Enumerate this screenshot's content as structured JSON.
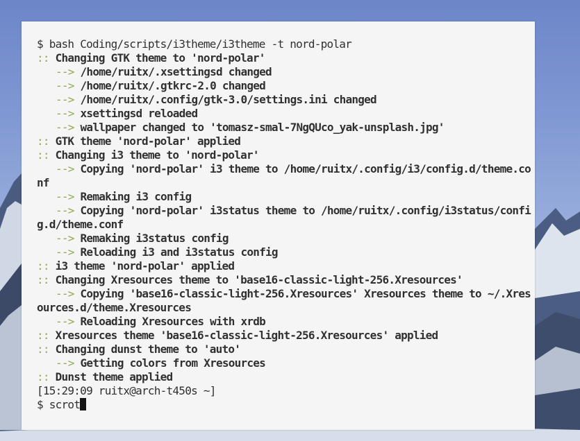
{
  "wallpaper": {
    "name": "tomasz-smal-7NgQUco_yak-unsplash.jpg"
  },
  "colors": {
    "terminal_bg": "#f5f5f5",
    "text": "#303030",
    "accent_green": "#90a959",
    "cursor": "#151515"
  },
  "terminal": {
    "lines": [
      {
        "type": "cmd",
        "prompt": "$",
        "text": "bash Coding/scripts/i3theme/i3theme -t nord-polar"
      },
      {
        "type": "msg",
        "marker": "::",
        "text": "Changing GTK theme to 'nord-polar'"
      },
      {
        "type": "sub",
        "marker": "-->",
        "text": "/home/ruitx/.xsettingsd changed"
      },
      {
        "type": "sub",
        "marker": "-->",
        "text": "/home/ruitx/.gtkrc-2.0 changed"
      },
      {
        "type": "sub",
        "marker": "-->",
        "text": "/home/ruitx/.config/gtk-3.0/settings.ini changed"
      },
      {
        "type": "sub",
        "marker": "-->",
        "text": "xsettingsd reloaded"
      },
      {
        "type": "sub",
        "marker": "-->",
        "text": "wallpaper changed to 'tomasz-smal-7NgQUco_yak-unsplash.jpg'"
      },
      {
        "type": "msg",
        "marker": "::",
        "text": "GTK theme 'nord-polar' applied"
      },
      {
        "type": "msg",
        "marker": "::",
        "text": "Changing i3 theme to 'nord-polar'"
      },
      {
        "type": "sub",
        "marker": "-->",
        "text": "Copying 'nord-polar' i3 theme to /home/ruitx/.config/i3/config.d/theme.co"
      },
      {
        "type": "wrap",
        "text": "nf"
      },
      {
        "type": "sub",
        "marker": "-->",
        "text": "Remaking i3 config"
      },
      {
        "type": "sub",
        "marker": "-->",
        "text": "Copying 'nord-polar' i3status theme to /home/ruitx/.config/i3status/confi"
      },
      {
        "type": "wrap",
        "text": "g.d/theme.conf"
      },
      {
        "type": "sub",
        "marker": "-->",
        "text": "Remaking i3status config"
      },
      {
        "type": "sub",
        "marker": "-->",
        "text": "Reloading i3 and i3status config"
      },
      {
        "type": "msg",
        "marker": "::",
        "text": "i3 theme 'nord-polar' applied"
      },
      {
        "type": "msg",
        "marker": "::",
        "text": "Changing Xresources theme to 'base16-classic-light-256.Xresources'"
      },
      {
        "type": "sub",
        "marker": "-->",
        "text": "Copying 'base16-classic-light-256.Xresources' Xresources theme to ~/.Xres"
      },
      {
        "type": "wrap",
        "text": "ources.d/theme.Xresources"
      },
      {
        "type": "sub",
        "marker": "-->",
        "text": "Reloading Xresources with xrdb"
      },
      {
        "type": "msg",
        "marker": "::",
        "text": "Xresources theme 'base16-classic-light-256.Xresources' applied"
      },
      {
        "type": "msg",
        "marker": "::",
        "text": "Changing dunst theme to 'auto'"
      },
      {
        "type": "sub",
        "marker": "-->",
        "text": "Getting colors from Xresources"
      },
      {
        "type": "msg",
        "marker": "::",
        "text": "Dunst theme applied"
      },
      {
        "type": "plain",
        "text": "[15:29:09 ruitx@arch-t450s ~]"
      },
      {
        "type": "input",
        "prompt": "$",
        "text": "scrot"
      }
    ]
  }
}
